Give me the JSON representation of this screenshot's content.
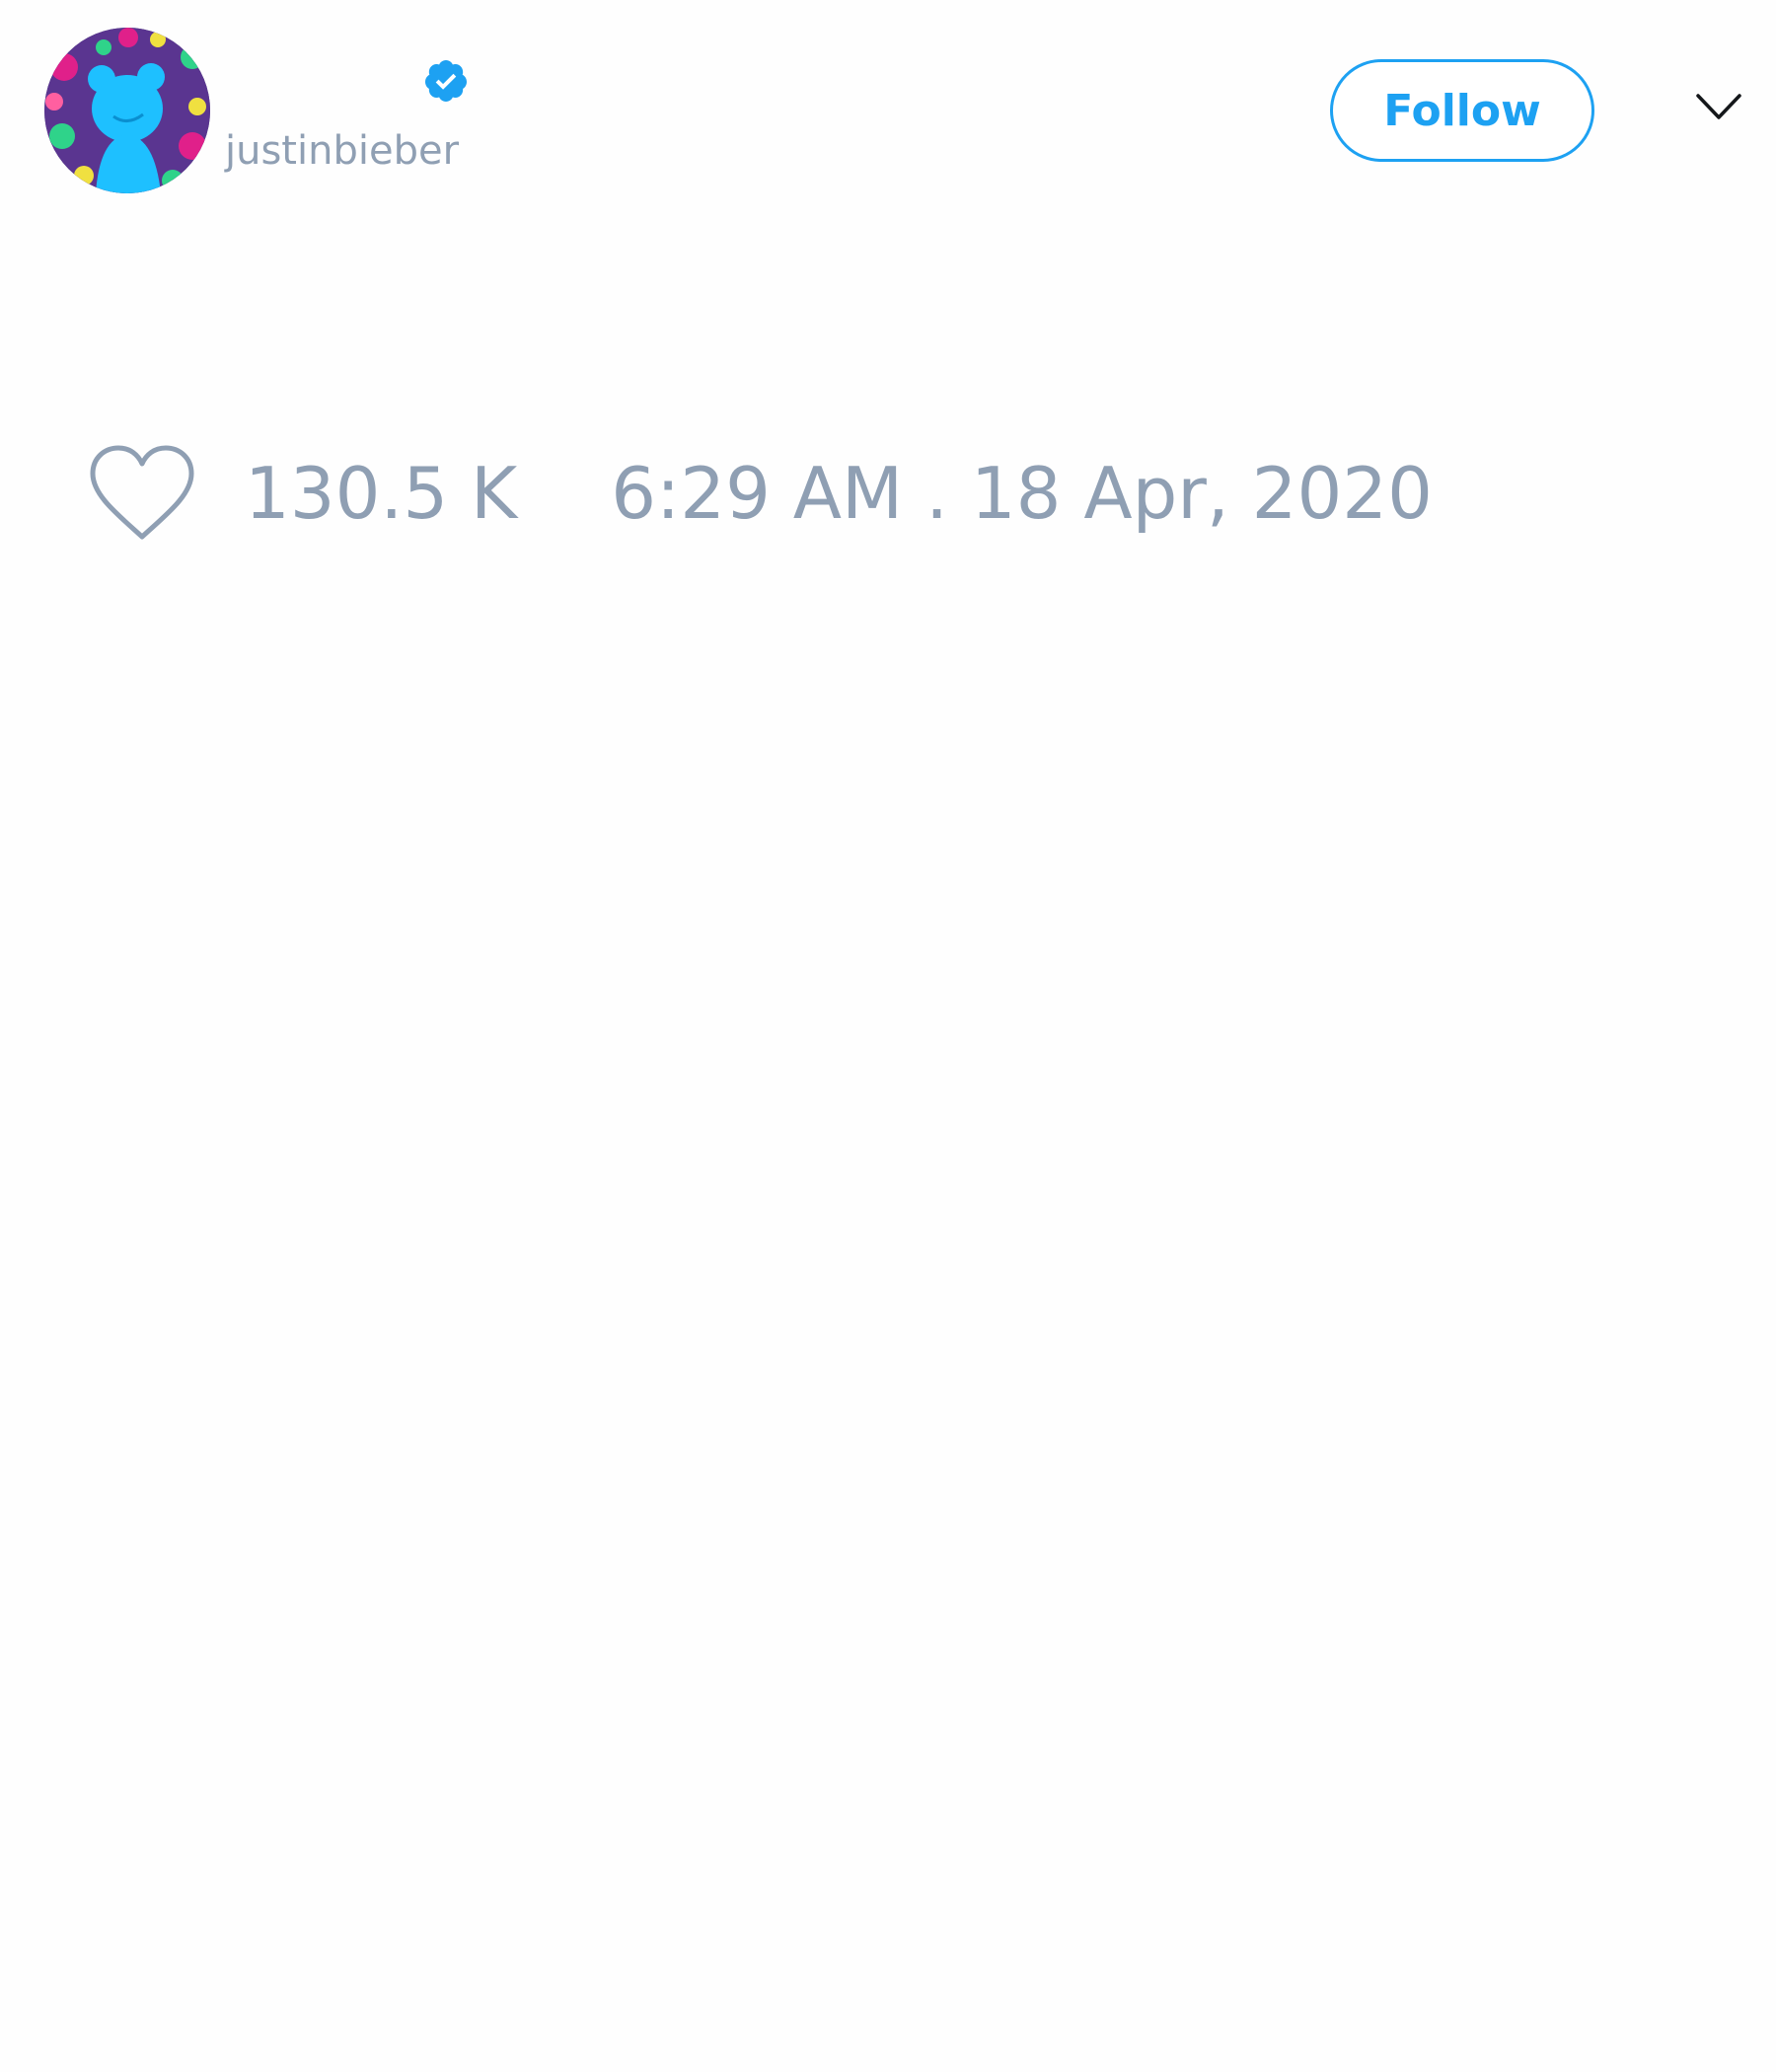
{
  "author": {
    "display_name": "",
    "handle": "justinbieber",
    "verified": true,
    "avatar_icon": "cartoon-bear-avatar"
  },
  "header": {
    "follow_label": "Follow",
    "menu_icon": "chevron-down-icon"
  },
  "stats": {
    "like_icon": "heart-outline-icon",
    "like_count": "130.5 K",
    "timestamp": "6:29 AM . 18 Apr, 2020"
  },
  "colors": {
    "accent": "#1da1f2",
    "muted_text": "#8f9fb3",
    "background": "#fefefe"
  }
}
